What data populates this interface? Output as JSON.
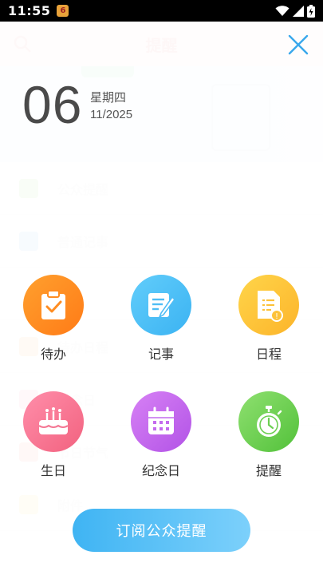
{
  "status_bar": {
    "time": "11:55",
    "notification_badge": "6"
  },
  "background": {
    "header_title": "提醒",
    "banner_text": "",
    "list": [
      {
        "label": "公众提醒",
        "color": "#7bc94f"
      },
      {
        "label": "普通记事",
        "color": "#4fa9e8"
      },
      {
        "label": "",
        "color": "#ffffff"
      },
      {
        "label": "待办日程",
        "color": "#f79a2a"
      },
      {
        "label": "纪念日",
        "color": "#f06d8f"
      },
      {
        "label": "节日节气",
        "color": "#f06a57"
      },
      {
        "label": "附件",
        "color": "#f6c94a"
      }
    ]
  },
  "date": {
    "day": "06",
    "weekday": "星期四",
    "month_year": "11/2025"
  },
  "actions": [
    {
      "label": "待办",
      "icon": "todo-clipboard-icon",
      "color_from": "#ffa02e",
      "color_to": "#ff7b17"
    },
    {
      "label": "记事",
      "icon": "note-pen-icon",
      "color_from": "#62cdfb",
      "color_to": "#3bb3f2"
    },
    {
      "label": "日程",
      "icon": "schedule-list-icon",
      "color_from": "#ffd54a",
      "color_to": "#fcb42a"
    },
    {
      "label": "生日",
      "icon": "birthday-cake-icon",
      "color_from": "#ff8eaa",
      "color_to": "#f2627f"
    },
    {
      "label": "纪念日",
      "icon": "calendar-icon",
      "color_from": "#d781f5",
      "color_to": "#b253e6"
    },
    {
      "label": "提醒",
      "icon": "stopwatch-icon",
      "color_from": "#8fe070",
      "color_to": "#52c13a"
    }
  ],
  "subscribe_button": {
    "label": "订阅公众提醒"
  },
  "accent_color": "#3aa8ec"
}
